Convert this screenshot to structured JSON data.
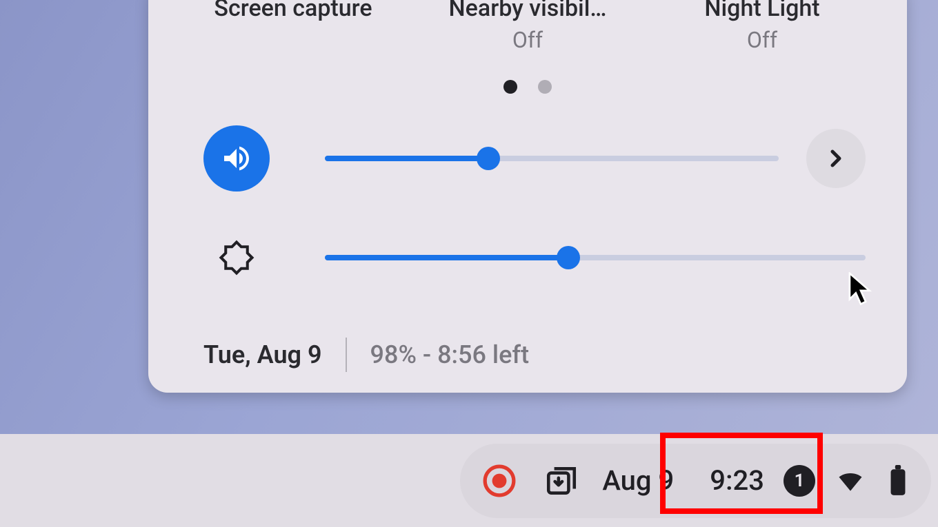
{
  "toggles": {
    "screen_capture": {
      "label": "Screen capture"
    },
    "nearby": {
      "label": "Nearby visibil…",
      "state": "Off"
    },
    "night_light": {
      "label": "Night Light",
      "state": "Off"
    }
  },
  "sliders": {
    "volume": {
      "value": 36
    },
    "brightness": {
      "value": 45
    }
  },
  "info": {
    "date": "Tue, Aug 9",
    "battery": "98% - 8:56 left"
  },
  "tray": {
    "date": "Aug 9",
    "time": "9:23",
    "badge_count": "1"
  }
}
